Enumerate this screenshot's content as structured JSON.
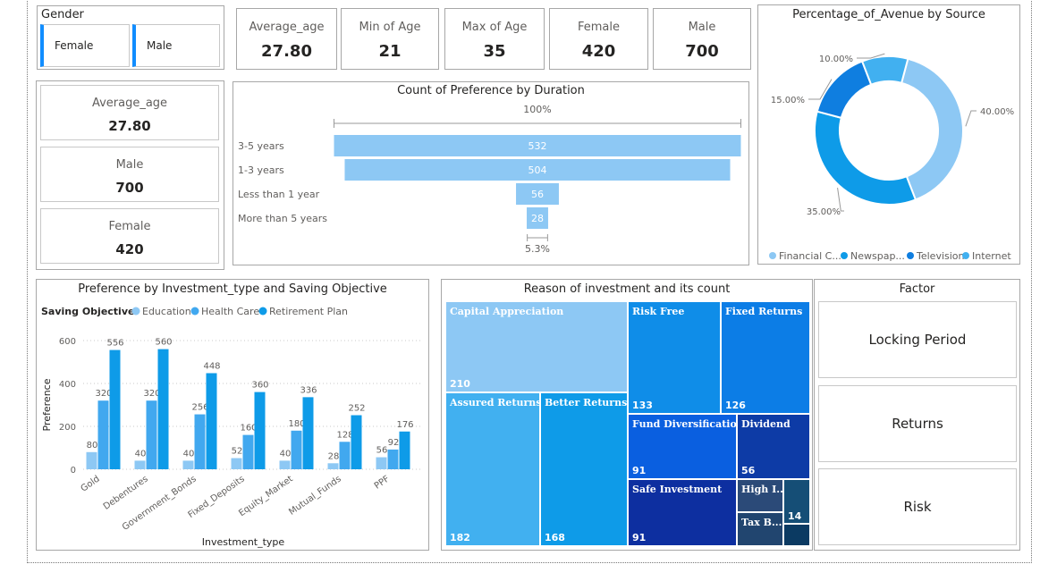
{
  "colors": {
    "accent": "#118dff",
    "education": "#8dc8f4",
    "health_care": "#41a8ef",
    "retirement": "#0e9be8"
  },
  "gender_slicer": {
    "title": "Gender",
    "options": [
      "Female",
      "Male"
    ]
  },
  "kpi_cards": [
    {
      "label": "Average_age",
      "value": "27.80"
    },
    {
      "label": "Min of Age",
      "value": "21"
    },
    {
      "label": "Max of Age",
      "value": "35"
    },
    {
      "label": "Female",
      "value": "420"
    },
    {
      "label": "Male",
      "value": "700"
    }
  ],
  "left_cards": [
    {
      "label": "Average_age",
      "value": "27.80"
    },
    {
      "label": "Male",
      "value": "700"
    },
    {
      "label": "Female",
      "value": "420"
    }
  ],
  "funnel": {
    "title": "Count of Preference by Duration",
    "top_pct": "100%",
    "bottom_pct": "5.3%"
  },
  "donut": {
    "title": "Percentage_of_Avenue by Source"
  },
  "bar": {
    "title": "Preference by Investment_type and Saving Objective",
    "legend_title": "Saving Objective"
  },
  "treemap": {
    "title": "Reason of investment and its count"
  },
  "factor": {
    "title": "Factor",
    "items": [
      "Locking Period",
      "Returns",
      "Risk"
    ]
  },
  "chart_data": [
    {
      "type": "bar",
      "orientation": "horizontal-funnel",
      "title": "Count of Preference by Duration",
      "categories": [
        "3-5 years",
        "1-3 years",
        "Less than 1 year",
        "More than 5 years"
      ],
      "values": [
        532,
        504,
        56,
        28
      ],
      "color": "#8dc8f4"
    },
    {
      "type": "pie",
      "donut": true,
      "title": "Percentage_of_Avenue by Source",
      "slices": [
        {
          "label": "Financial C...",
          "value": 40.0,
          "display": "40.00%",
          "color": "#8dc8f4"
        },
        {
          "label": "Newspap...",
          "value": 35.0,
          "display": "35.00%",
          "color": "#0e9be8"
        },
        {
          "label": "Television",
          "value": 15.0,
          "display": "15.00%",
          "color": "#0f7ee0"
        },
        {
          "label": "Internet",
          "value": 10.0,
          "display": "10.00%",
          "color": "#41b0f0"
        }
      ],
      "legend_position": "bottom"
    },
    {
      "type": "bar",
      "title": "Preference by Investment_type and Saving Objective",
      "xlabel": "Investment_type",
      "ylabel": "Preference",
      "ylim": [
        0,
        600
      ],
      "yticks": [
        0,
        200,
        400,
        600
      ],
      "categories": [
        "Gold",
        "Debentures",
        "Government_Bonds",
        "Fixed_Deposits",
        "Equity_Market",
        "Mutual_Funds",
        "PPF"
      ],
      "series": [
        {
          "name": "Education",
          "values": [
            80,
            40,
            40,
            52,
            40,
            28,
            56
          ],
          "color": "#8dc8f4"
        },
        {
          "name": "Health Care",
          "values": [
            320,
            320,
            256,
            160,
            180,
            128,
            92
          ],
          "color": "#41a8ef"
        },
        {
          "name": "Retirement Plan",
          "values": [
            556,
            560,
            448,
            360,
            336,
            252,
            176
          ],
          "color": "#0e9be8"
        }
      ],
      "grid": true,
      "legend_position": "top-left"
    },
    {
      "type": "treemap",
      "title": "Reason of investment and its count",
      "groups": [
        {
          "items": [
            {
              "label": "Capital Appreciation",
              "value": 210
            },
            {
              "label": "Assured Returns",
              "value": 182
            },
            {
              "label": "Better Returns",
              "value": 168
            }
          ]
        },
        {
          "items": [
            {
              "label": "Risk Free",
              "value": 133
            },
            {
              "label": "Fixed Returns",
              "value": 126
            },
            {
              "label": "Fund Diversification",
              "value": 91
            },
            {
              "label": "Dividend",
              "value": 56
            },
            {
              "label": "Safe Investment",
              "value": 91
            },
            {
              "label": "High I...",
              "value": null
            },
            {
              "label": "Tax B...",
              "value": null
            },
            {
              "label": "",
              "value": 14
            },
            {
              "label": "",
              "value": null
            }
          ]
        }
      ]
    }
  ]
}
